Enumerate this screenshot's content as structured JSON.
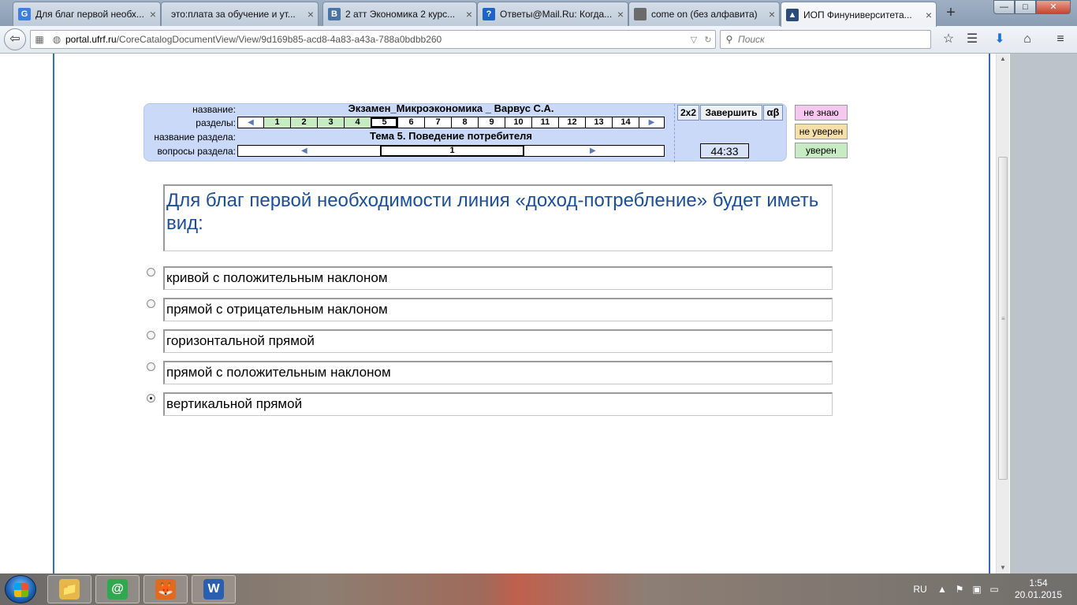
{
  "tabs": [
    {
      "title": "Для благ первой необх...",
      "favicon": "G",
      "color": "#3f7ee8"
    },
    {
      "title": "это:плата за обучение и ут...",
      "favicon": "",
      "color": ""
    },
    {
      "title": "2 атт Экономика 2 курс...",
      "favicon": "B",
      "color": "#4a74a6"
    },
    {
      "title": "Ответы@Mail.Ru: Когда...",
      "favicon": "?",
      "color": "#1f63c6"
    },
    {
      "title": "come on (без алфавита)",
      "favicon": "",
      "color": "#6b6b6b"
    },
    {
      "title": "ИОП Финуниверситета...",
      "favicon": "▲",
      "color": "#2c4a7a",
      "active": true
    }
  ],
  "window_controls": {
    "minimize": "—",
    "maximize": "□",
    "close": "✕"
  },
  "nav": {
    "url_host": "portal.ufrf.ru",
    "url_path": "/CoreCatalogDocumentView/View/9d169b85-acd8-4a83-a43a-788a0bdbb260",
    "search_placeholder": "Поиск"
  },
  "exam": {
    "labels": {
      "name": "название:",
      "sections": "разделы:",
      "section_name": "название раздела:",
      "section_questions": "вопросы раздела:"
    },
    "title": "Экзамен_Микроэкономика _ Варвус С.А.",
    "sections": [
      {
        "n": "1",
        "done": true
      },
      {
        "n": "2",
        "done": true
      },
      {
        "n": "3",
        "done": true
      },
      {
        "n": "4",
        "done": true
      },
      {
        "n": "5",
        "current": true
      },
      {
        "n": "6"
      },
      {
        "n": "7"
      },
      {
        "n": "8"
      },
      {
        "n": "9"
      },
      {
        "n": "10"
      },
      {
        "n": "11"
      },
      {
        "n": "12"
      },
      {
        "n": "13"
      },
      {
        "n": "14"
      }
    ],
    "section_title": "Тема 5. Поведение потребителя",
    "current_question": "1",
    "buttons": {
      "calc": "2x2",
      "finish": "Завершить",
      "alpha": "αβ"
    },
    "timer": "44:33",
    "confidence": {
      "dont_know": "не знаю",
      "unsure": "не уверен",
      "sure": "уверен"
    }
  },
  "question": {
    "text": "Для благ первой необходимости линия «доход-потребление» будет иметь вид:",
    "answers": [
      {
        "text": "кривой с положительным наклоном",
        "selected": false
      },
      {
        "text": "прямой с отрицательным наклоном",
        "selected": false
      },
      {
        "text": "горизонтальной прямой",
        "selected": false
      },
      {
        "text": "прямой с положительным наклоном",
        "selected": false
      },
      {
        "text": "вертикальной прямой",
        "selected": true
      }
    ]
  },
  "taskbar": {
    "apps": [
      {
        "name": "explorer",
        "icon": "📁",
        "color": "#e6b84a"
      },
      {
        "name": "mail-agent",
        "icon": "@",
        "color": "#2fa84f"
      },
      {
        "name": "firefox",
        "icon": "🦊",
        "color": "#e06a1f"
      },
      {
        "name": "word",
        "icon": "W",
        "color": "#2a5fb0"
      }
    ],
    "lang": "RU",
    "time": "1:54",
    "date": "20.01.2015"
  }
}
